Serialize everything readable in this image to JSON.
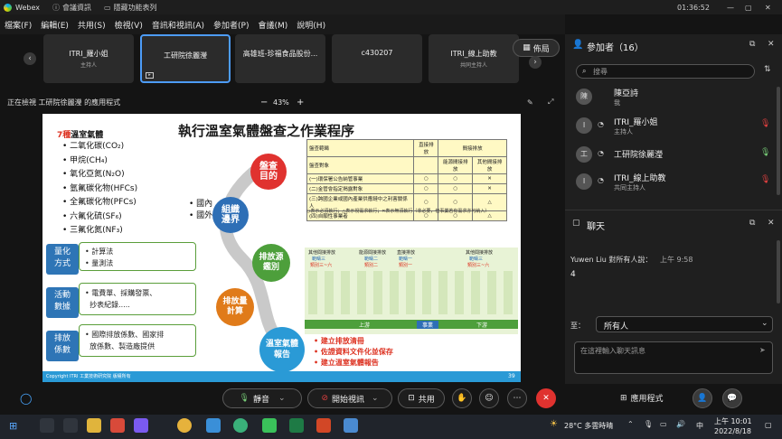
{
  "titlebar": {
    "app": "Webex",
    "tab1": "會議資訊",
    "tab2": "隱藏功能表列",
    "time": "01:36:52"
  },
  "menu": [
    "檔案(F)",
    "編輯(E)",
    "共用(S)",
    "檢視(V)",
    "音訊和視訊(A)",
    "參加者(P)",
    "會議(M)",
    "說明(H)"
  ],
  "strip": {
    "tiles": [
      {
        "name": "ITRI_羅小姐",
        "role": "主持人"
      },
      {
        "name": "工研院徐麗瀅",
        "role": ""
      },
      {
        "name": "高雄班-珍福食品股份...",
        "role": ""
      },
      {
        "name": "c430207",
        "role": ""
      },
      {
        "name": "ITRI_線上助教",
        "role": "共同主持人"
      }
    ],
    "layout_label": "佈局"
  },
  "share": {
    "viewing": "正在檢視 工研院徐麗瀅 的應用程式",
    "zoom": "43%",
    "minus": "−",
    "plus": "+"
  },
  "slide": {
    "title": "執行溫室氣體盤查之作業程序",
    "gas_heading_num": "7種",
    "gas_heading": "溫室氣體",
    "gases": [
      "二氧化碳(CO₂)",
      "甲烷(CH₄)",
      "氧化亞氮(N₂O)",
      "氫氟碳化物(HFCs)",
      "全氟碳化物(PFCs)",
      "六氟化硫(SF₆)",
      "三氟化氮(NF₃)"
    ],
    "scope_opts": [
      "國內",
      "國外"
    ],
    "circle_check": "盤查\n目的",
    "circle_org": "組織\n邊界",
    "circle_source": "排放源\n鑑別",
    "circle_calc": "排放量\n計算",
    "circle_report": "溫室氣體\n報告",
    "quant_label": "量化\n方式",
    "quant_items": [
      "計算法",
      "量測法"
    ],
    "activity_label": "活動\n數據",
    "activity_items": [
      "電費單、採購發票、",
      "抄表紀錄....."
    ],
    "factor_label": "排放\n係數",
    "factor_items": [
      "國際排放係數、國家排",
      "放係數、製造廠提供"
    ],
    "report_items": [
      "建立排放清冊",
      "佐證資料文件化並保存",
      "建立溫室氣體報告"
    ],
    "table_head": [
      "盤查範疇",
      "直接排放",
      "間接排放"
    ],
    "table_subhead": [
      "盤查對象",
      "",
      "能源間接排放",
      "其他間接排放"
    ],
    "table_rows": [
      [
        "(一)環保署公告納管事業",
        "○",
        "○",
        "✕"
      ],
      [
        "(二)金管會指定揭露對象",
        "○",
        "○",
        "✕"
      ],
      [
        "(三)跨國企業或國內產業供應鏈中之利害關係人",
        "○",
        "○",
        "△"
      ],
      [
        "(四)自願性事業者",
        "○",
        "○",
        "△"
      ]
    ],
    "table_note": "○表示必須執行；△表示視需求執行；✕表示無須執行（非必要，但事業若有需求亦可納入）",
    "flow_labels": {
      "other_indirect": "其他間接排放",
      "scope3": "範疇三",
      "cat36": "類別三~六",
      "energy_indirect": "能源間接排放",
      "scope2": "範疇二",
      "cat2": "類別二",
      "direct": "直接排放",
      "scope1": "範疇一",
      "cat1": "類別一",
      "up": "上游",
      "biz": "事業",
      "down": "下游"
    },
    "footer_copy": "Copyright ITRI 工業技術研究院 版權所有",
    "page": "39"
  },
  "panel": {
    "participants_title": "參加者（16）",
    "search_placeholder": "搜尋",
    "participants": [
      {
        "name": "陳亞詩",
        "role": "我",
        "initial": "陳"
      },
      {
        "name": "ITRI_羅小姐",
        "role": "主持人",
        "initial": "I"
      },
      {
        "name": "工研院徐麗瀅",
        "role": "",
        "initial": "工"
      },
      {
        "name": "ITRI_線上助教",
        "role": "共同主持人",
        "initial": "I"
      }
    ],
    "chat_title": "聊天",
    "chat_sender": "Yuwen Liu 對所有人說：",
    "chat_time": "上午 9:58",
    "chat_msg": "4",
    "to_label": "至：",
    "to_value": "所有人",
    "chat_placeholder": "在這裡輸入聊天訊息"
  },
  "controls": {
    "mute": "靜音",
    "video": "開始視訊",
    "share": "共用",
    "apps": "應用程式"
  },
  "taskbar": {
    "weather": "28°C 多雲時晴",
    "ime": "中",
    "time": "上午 10:01",
    "date": "2022/8/18"
  }
}
